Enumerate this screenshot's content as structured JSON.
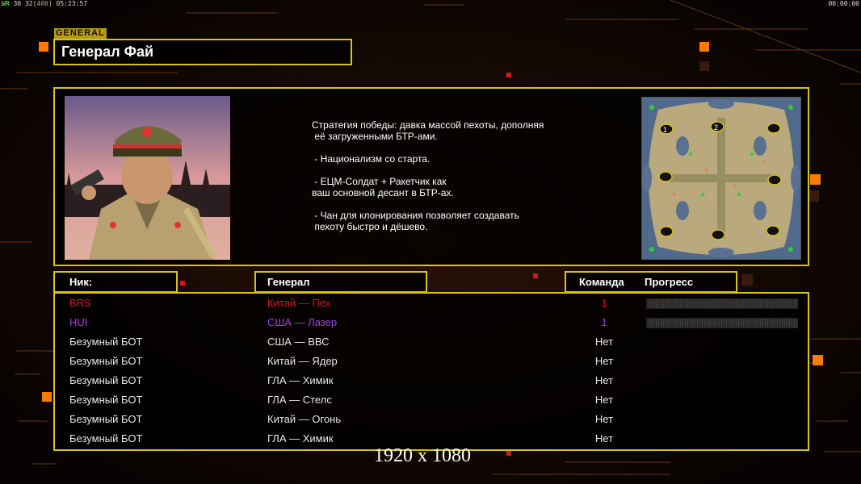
{
  "topbar": {
    "fps_label": "ЫR",
    "fps_a": "30",
    "fps_b": "32",
    "fps_c": "[400]",
    "clock": "05:23:57",
    "timer": "00:00:00"
  },
  "general": {
    "tag": "GENERAL",
    "name": "Генерал Фай",
    "description": "Стратегия победы: давка массой пехоты, дополняя\n её загруженными БТР-ами.\n\n - Национализм со старта.\n\n - ЕЦМ-Солдат + Ракетчик как\nваш основной десант в БТР-ах.\n\n - Чан для клонирования позволяет создавать\n пехоту быстро и дёшево."
  },
  "map": {
    "slot_labels": [
      "1",
      "2"
    ]
  },
  "headers": {
    "nick": "Ник:",
    "general": "Генерал",
    "team": "Команда",
    "progress": "Прогресс"
  },
  "players": [
    {
      "nick": "BRS",
      "general": "Китай — Пех",
      "team": "1",
      "color": "#e0141b",
      "has_progress": true
    },
    {
      "nick": "HUI",
      "general": "США — Лазер",
      "team": "1",
      "color": "#a43ed6",
      "has_progress": true
    },
    {
      "nick": "Безумный БОТ",
      "general": "США — ВВС",
      "team": "Нет",
      "color": "#ffffff",
      "has_progress": false
    },
    {
      "nick": "Безумный БОТ",
      "general": "Китай — Ядер",
      "team": "Нет",
      "color": "#ffffff",
      "has_progress": false
    },
    {
      "nick": "Безумный БОТ",
      "general": "ГЛА — Химик",
      "team": "Нет",
      "color": "#ffffff",
      "has_progress": false
    },
    {
      "nick": "Безумный БОТ",
      "general": "ГЛА — Стелс",
      "team": "Нет",
      "color": "#ffffff",
      "has_progress": false
    },
    {
      "nick": "Безумный БОТ",
      "general": "Китай — Огонь",
      "team": "Нет",
      "color": "#ffffff",
      "has_progress": false
    },
    {
      "nick": "Безумный БОТ",
      "general": "ГЛА — Химик",
      "team": "Нет",
      "color": "#ffffff",
      "has_progress": false
    }
  ],
  "resolution": "1920 x 1080",
  "colors": {
    "accent": "#d8c21a",
    "orange": "#ff8a00",
    "red": "#e0141b"
  }
}
